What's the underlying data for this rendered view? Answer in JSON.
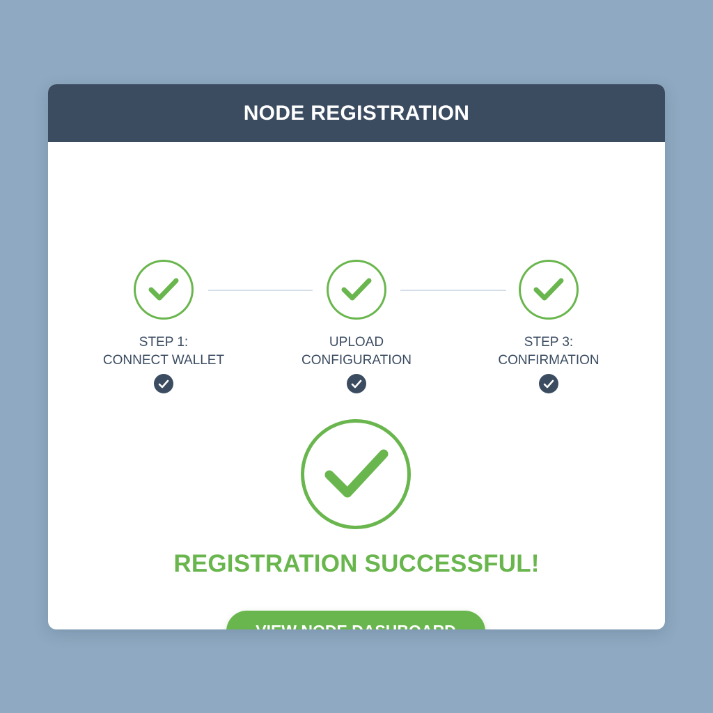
{
  "colors": {
    "page_background": "#8ea9c1",
    "header_background": "#3b4c61",
    "accent_green": "#6ab64e",
    "label_text": "#3b4c61",
    "connector_line": "#d4dee8"
  },
  "header": {
    "title": "NODE REGISTRATION"
  },
  "steps": [
    {
      "line1": "STEP 1:",
      "line2": "CONNECT WALLET",
      "status": "complete",
      "icon": "check-circle-icon",
      "badge_icon": "check-badge-icon"
    },
    {
      "line1": "UPLOAD",
      "line2": "CONFIGURATION",
      "status": "complete",
      "icon": "check-circle-icon",
      "badge_icon": "check-badge-icon"
    },
    {
      "line1": "STEP 3:",
      "line2": "CONFIRMATION",
      "status": "complete",
      "icon": "check-circle-icon",
      "badge_icon": "check-badge-icon"
    }
  ],
  "success": {
    "icon": "large-check-circle-icon",
    "message": "REGISTRATION SUCCESSFUL!"
  },
  "actions": {
    "dashboard_button_label": "VIEW NODE DASHBOARD"
  }
}
